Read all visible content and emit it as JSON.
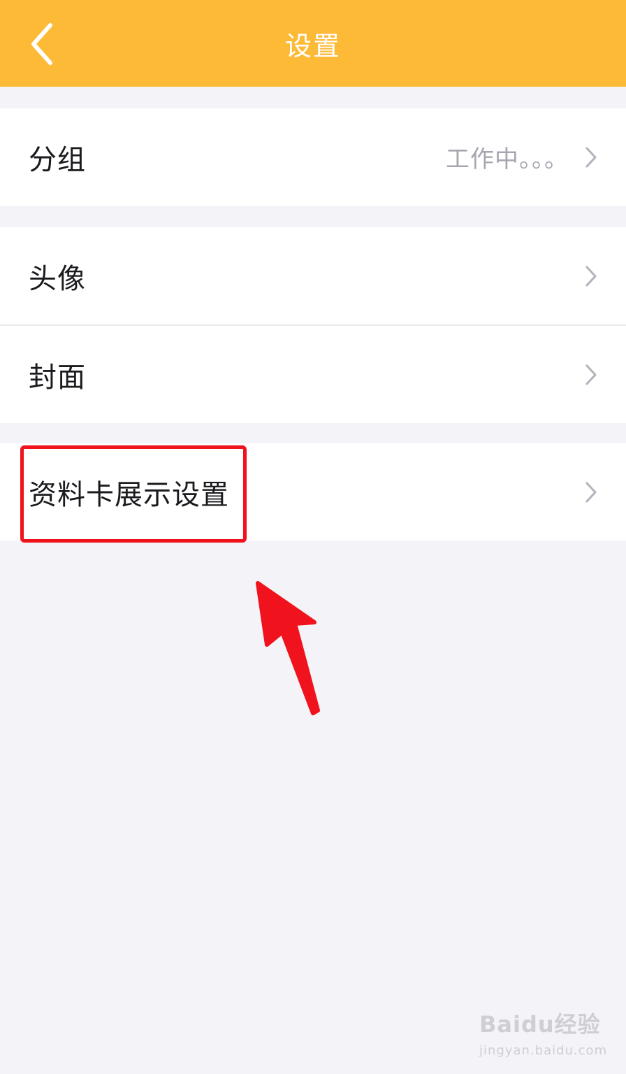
{
  "header": {
    "title": "设置",
    "back_icon": "chevron-left-icon",
    "background_color": "#fdba37"
  },
  "groups": [
    {
      "rows": [
        {
          "label": "分组",
          "value": "工作中。。。",
          "icon": "chevron-right-icon"
        }
      ]
    },
    {
      "rows": [
        {
          "label": "头像",
          "icon": "chevron-right-icon"
        },
        {
          "label": "封面",
          "icon": "chevron-right-icon"
        }
      ]
    },
    {
      "rows": [
        {
          "label": "资料卡展示设置",
          "icon": "chevron-right-icon"
        }
      ]
    }
  ],
  "annotation": {
    "highlight_color": "#f0121c"
  },
  "watermark": {
    "logo": "Baidu经验",
    "url": "jingyan.baidu.com"
  }
}
